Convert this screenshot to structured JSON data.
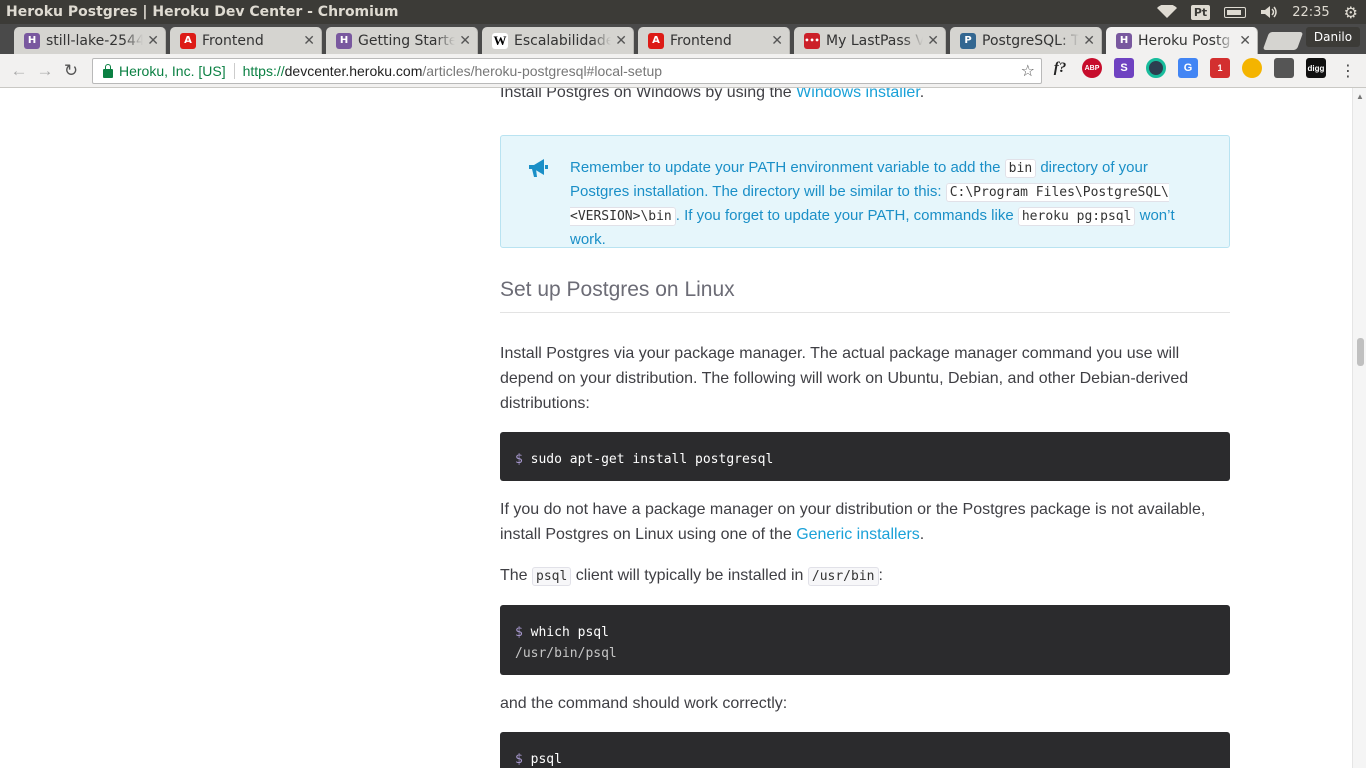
{
  "os": {
    "window_title": "Heroku Postgres | Heroku Dev Center - Chromium",
    "keyboard_layout": "Pt",
    "clock": "22:35"
  },
  "tabs": [
    {
      "title": "still-lake-2544",
      "favicon": "heroku-icon",
      "color": "#79589f"
    },
    {
      "title": "Frontend",
      "favicon": "angular-icon",
      "color": "#dd1b16"
    },
    {
      "title": "Getting Starte",
      "favicon": "heroku-icon",
      "color": "#79589f"
    },
    {
      "title": "Escalabilidade",
      "favicon": "wikipedia-icon",
      "color": "#ffffff"
    },
    {
      "title": "Frontend",
      "favicon": "angular-icon",
      "color": "#dd1b16"
    },
    {
      "title": "My LastPass V",
      "favicon": "lastpass-icon",
      "color": "#cc2029"
    },
    {
      "title": "PostgreSQL: T",
      "favicon": "postgresql-icon",
      "color": "#336791"
    },
    {
      "title": "Heroku Postg",
      "favicon": "heroku-icon",
      "color": "#79589f",
      "active": true
    }
  ],
  "profile_name": "Danilo",
  "omnibox": {
    "security_label": "Heroku, Inc. [US]",
    "url_scheme": "https://",
    "url_host": "devcenter.heroku.com",
    "url_path": "/articles/heroku-postgresql#local-setup"
  },
  "extensions": [
    {
      "name": "font-finder-icon",
      "label": "f?",
      "color": "#f2f1f0",
      "text_color": "#222"
    },
    {
      "name": "adblock-plus-icon",
      "label": "ABP",
      "color": "#c70d2c",
      "text_color": "#fff"
    },
    {
      "name": "s-extension-icon",
      "label": "S",
      "color": "#6f42c1",
      "text_color": "#fff"
    },
    {
      "name": "circle-extension-icon",
      "label": "",
      "color": "#2c3e50",
      "text_color": "#fff"
    },
    {
      "name": "google-translate-icon",
      "label": "G",
      "color": "#4285f4",
      "text_color": "#fff"
    },
    {
      "name": "counter-extension-icon",
      "label": "1",
      "color": "#d32f2f",
      "text_color": "#fff"
    },
    {
      "name": "moon-extension-icon",
      "label": "",
      "color": "#f4b400",
      "text_color": "#fff"
    },
    {
      "name": "puzzle-extension-icon",
      "label": "",
      "color": "#555555",
      "text_color": "#fff"
    },
    {
      "name": "digg-icon",
      "label": "digg",
      "color": "#111111",
      "text_color": "#fff"
    }
  ],
  "article": {
    "top_line_prefix": "Install Postgres on Windows by using the ",
    "top_line_link": "Windows installer",
    "top_line_suffix": ".",
    "callout": {
      "t1": "Remember to update your PATH environment variable to add the ",
      "c1": "bin",
      "t2": " directory of your Postgres installation. The directory will be similar to this: ",
      "c2": "C:\\Program Files\\PostgreSQL\\<VERSION>\\bin",
      "t3": ". If you forget to update your PATH, commands like ",
      "c3": "heroku pg:psql",
      "t4": " won’t work."
    },
    "section_heading": "Set up Postgres on Linux",
    "para1": "Install Postgres via your package manager. The actual package manager command you use will depend on your distribution. The following will work on Ubuntu, Debian, and other Debian-derived distributions:",
    "code1_prompt": "$",
    "code1_cmd": " sudo apt-get install postgresql",
    "para2_prefix": "If you do not have a package manager on your distribution or the Postgres package is not available, install Postgres on Linux using one of the ",
    "para2_link": "Generic installers",
    "para2_suffix": ".",
    "para3_t1": "The ",
    "para3_c1": "psql",
    "para3_t2": " client will typically be installed in ",
    "para3_c2": "/usr/bin",
    "para3_t3": ":",
    "code2_prompt": "$",
    "code2_cmd": " which psql",
    "code2_output": "/usr/bin/psql",
    "para4": "and the command should work correctly:",
    "code3_prompt": "$",
    "code3_cmd": " psql"
  }
}
